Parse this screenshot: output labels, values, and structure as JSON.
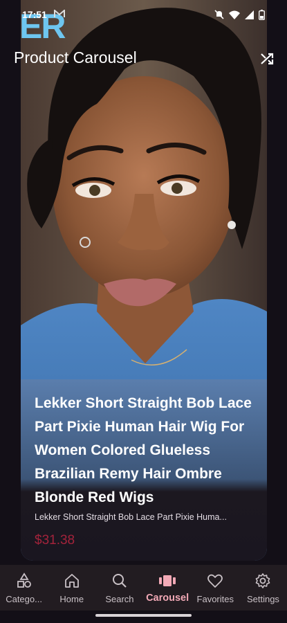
{
  "status_bar": {
    "time": "17:51",
    "left_icons": [
      "gmail-icon"
    ],
    "right_icons": [
      "mute-icon",
      "wifi-icon",
      "signal-icon",
      "battery-icon"
    ]
  },
  "header": {
    "title": "Product Carousel",
    "logo_fragment": "ER",
    "shuffle_icon": "shuffle-icon"
  },
  "product": {
    "title": "Lekker Short Straight Bob Lace Part Pixie Human Hair Wig For Women Colored Glueless Brazilian Remy Hair Ombre Blonde Red Wigs",
    "subtitle": "Lekker Short Straight Bob Lace Part Pixie Huma...",
    "price": "$31.38",
    "image_alt": "woman-with-short-bob-wig-photo"
  },
  "bottom_nav": {
    "items": [
      {
        "label": "Catego...",
        "icon": "categories-icon"
      },
      {
        "label": "Home",
        "icon": "home-icon"
      },
      {
        "label": "Search",
        "icon": "search-icon"
      },
      {
        "label": "Carousel",
        "icon": "carousel-icon",
        "active": true
      },
      {
        "label": "Favorites",
        "icon": "heart-icon"
      },
      {
        "label": "Settings",
        "icon": "gear-icon"
      }
    ]
  },
  "colors": {
    "background": "#130f17",
    "nav_background": "#221c21",
    "active_accent": "#f2a9b6",
    "price": "#a3233b",
    "logo": "#6ec6f0"
  }
}
